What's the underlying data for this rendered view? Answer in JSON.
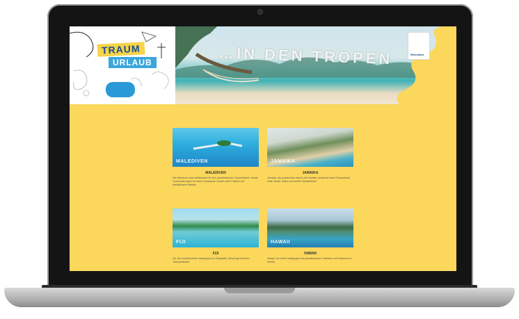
{
  "banner": {
    "logo_line1": "TRAUM",
    "logo_line2": "URLAUB",
    "bubble_text": "",
    "title": "…IN DEN TROPEN",
    "badge_text": "",
    "badge_brand": "Reiseland"
  },
  "cards": [
    {
      "image_label": "MALEDIVEN",
      "title": "MALEDIVEN",
      "text": "Die Malediven sind weltbekannt für ihre paradiesischen Traumstrände. Ideale Voraussetzungen für einen erholsamen Urlaub unter Palmen und kristallklarem Wasser."
    },
    {
      "image_label": "JAMAIKA",
      "title": "JAMAIKA",
      "text": "Jamaika, die pulsierende Insel in der Karibik, verspricht einen Traumurlaub voller Musik, Kultur und weißer Sandstrände."
    },
    {
      "image_label": "FIJI",
      "title": "FIJI",
      "text": "Fiji, die wunderschöne Inselgruppe im Südpazifik, überzeugt mit ihren Traumstränden."
    },
    {
      "image_label": "HAWAII",
      "title": "HAWAII",
      "text": "Hawaii, die bunte Inselgruppe mit paradiesischen Stränden und Vulkanen im Pazifik."
    }
  ],
  "colors": {
    "page_bg": "#fbd75b",
    "accent_blue": "#2a9ad6",
    "logo_yellow": "#f6d34a"
  }
}
